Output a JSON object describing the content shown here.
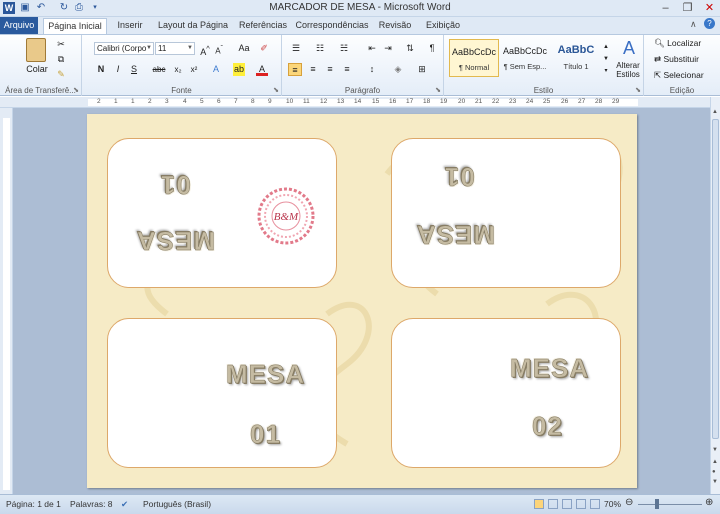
{
  "window": {
    "title": "MARCADOR DE MESA  -  Microsoft Word"
  },
  "quick_access": {
    "icons": [
      "word-icon",
      "save-icon",
      "undo-icon",
      "redo-icon",
      "print-preview-icon",
      "customize-icon"
    ]
  },
  "tabs": {
    "file": "Arquivo",
    "items": [
      "Página Inicial",
      "Inserir",
      "Layout da Página",
      "Referências",
      "Correspondências",
      "Revisão",
      "Exibição"
    ],
    "active": "Página Inicial"
  },
  "ribbon": {
    "clipboard": {
      "paste_label": "Colar",
      "group_label": "Área de Transferê..."
    },
    "font": {
      "family": "Calibri (Corpo",
      "size": "11",
      "group_label": "Fonte",
      "buttons": [
        "N",
        "I",
        "S",
        "abc",
        "x₂",
        "x²",
        "Aa"
      ]
    },
    "paragraph": {
      "group_label": "Parágrafo"
    },
    "styles": {
      "group_label": "Estilo",
      "items": [
        {
          "sample": "AaBbCcDc",
          "name": "¶ Normal"
        },
        {
          "sample": "AaBbCcDc",
          "name": "¶ Sem Esp..."
        },
        {
          "sample": "AaBbC",
          "name": "Título 1"
        }
      ],
      "change_label": "Alterar Estilos"
    },
    "editing": {
      "group_label": "Edição",
      "find": "Localizar",
      "replace": "Substituir",
      "select": "Selecionar"
    }
  },
  "ruler": {
    "numbers": [
      "2",
      "1",
      "1",
      "2",
      "3",
      "4",
      "5",
      "6",
      "7",
      "8",
      "9",
      "10",
      "11",
      "12",
      "13",
      "14",
      "15",
      "16",
      "17",
      "18",
      "19",
      "20",
      "21",
      "22",
      "23",
      "24",
      "25",
      "26",
      "27",
      "28",
      "29"
    ]
  },
  "document": {
    "cards": [
      {
        "word": "MESA",
        "number": "01",
        "inverted": true,
        "has_monogram": true
      },
      {
        "word": "MESA",
        "number": "01",
        "inverted": true,
        "has_monogram": false
      },
      {
        "word": "MESA",
        "number": "01",
        "inverted": false,
        "has_monogram": false
      },
      {
        "word": "MESA",
        "number": "02",
        "inverted": false,
        "has_monogram": false
      }
    ],
    "monogram": "B&M"
  },
  "status": {
    "page": "Página: 1 de 1",
    "words": "Palavras: 8",
    "language": "Português (Brasil)",
    "zoom": "70%"
  },
  "colors": {
    "file_tab": "#2a5a9e",
    "page_bg": "#f6ebc6",
    "card_border": "#dda86a",
    "doc_bg": "#acbdd4"
  }
}
